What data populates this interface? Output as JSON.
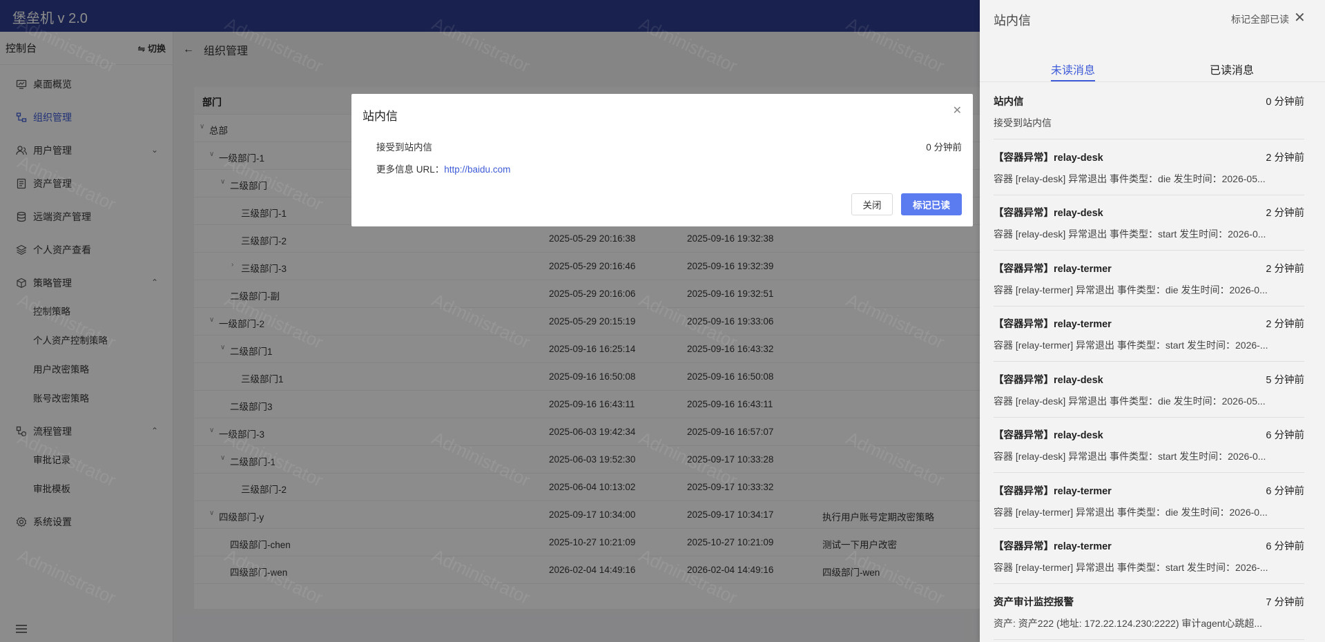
{
  "app": {
    "title": "堡垒机 v 2.0"
  },
  "sidebar": {
    "header_title": "控制台",
    "switch_label": "⇋ 切换",
    "items": [
      {
        "label": "桌面概览",
        "icon": "dashboard-icon"
      },
      {
        "label": "组织管理",
        "icon": "org-icon",
        "active": true
      },
      {
        "label": "用户管理",
        "icon": "users-icon"
      },
      {
        "label": "资产管理",
        "icon": "asset-icon"
      },
      {
        "label": "远端资产管理",
        "icon": "database-icon"
      },
      {
        "label": "个人资产查看",
        "icon": "layers-icon"
      },
      {
        "label": "策略管理",
        "icon": "cube-icon"
      },
      {
        "label": "流程管理",
        "icon": "flow-icon"
      },
      {
        "label": "系统设置",
        "icon": "settings-icon"
      }
    ],
    "policy_subitems": [
      "控制策略",
      "个人资产控制策略",
      "用户改密策略",
      "账号改密策略"
    ],
    "flow_subitems": [
      "审批记录",
      "审批模板"
    ]
  },
  "main": {
    "breadcrumb": "组织管理",
    "table": {
      "header_dept": "部门",
      "rows": [
        {
          "name": "总部",
          "created": "",
          "updated": "",
          "desc": ""
        },
        {
          "name": "一级部门-1",
          "created": "",
          "updated": "",
          "desc": ""
        },
        {
          "name": "二级部门",
          "created": "",
          "updated": "",
          "desc": ""
        },
        {
          "name": "三级部门-1",
          "created": "",
          "updated": "",
          "desc": ""
        },
        {
          "name": "三级部门-2",
          "created": "2025-05-29 20:16:38",
          "updated": "2025-09-16 19:32:38",
          "desc": ""
        },
        {
          "name": "三级部门-3",
          "created": "2025-05-29 20:16:46",
          "updated": "2025-09-16 19:32:39",
          "desc": ""
        },
        {
          "name": "二级部门-副",
          "created": "2025-05-29 20:16:06",
          "updated": "2025-09-16 19:32:51",
          "desc": ""
        },
        {
          "name": "一级部门-2",
          "created": "2025-05-29 20:15:19",
          "updated": "2025-09-16 19:33:06",
          "desc": ""
        },
        {
          "name": "二级部门1",
          "created": "2025-09-16 16:25:14",
          "updated": "2025-09-16 16:43:32",
          "desc": ""
        },
        {
          "name": "三级部门1",
          "created": "2025-09-16 16:50:08",
          "updated": "2025-09-16 16:50:08",
          "desc": ""
        },
        {
          "name": "二级部门3",
          "created": "2025-09-16 16:43:11",
          "updated": "2025-09-16 16:43:11",
          "desc": ""
        },
        {
          "name": "一级部门-3",
          "created": "2025-06-03 19:42:34",
          "updated": "2025-09-16 16:57:07",
          "desc": ""
        },
        {
          "name": "二级部门-1",
          "created": "2025-06-03 19:52:30",
          "updated": "2025-09-17 10:33:28",
          "desc": ""
        },
        {
          "name": "三级部门-2",
          "created": "2025-06-04 10:13:02",
          "updated": "2025-09-17 10:33:32",
          "desc": ""
        },
        {
          "name": "四级部门-y",
          "created": "2025-09-17 10:34:00",
          "updated": "2025-09-17 10:34:17",
          "desc": "执行用户账号定期改密策略"
        },
        {
          "name": "四级部门-chen",
          "created": "2025-10-27 10:21:09",
          "updated": "2025-10-27 10:21:09",
          "desc": "测试一下用户改密"
        },
        {
          "name": "四级部门-wen",
          "created": "2026-02-04 14:49:16",
          "updated": "2026-02-04 14:49:16",
          "desc": "四级部门-wen"
        }
      ]
    }
  },
  "watermark": "Administrator",
  "modal": {
    "title": "站内信",
    "content": "接受到站内信",
    "time": "0 分钟前",
    "url_label": "更多信息 URL：",
    "url": "http://baidu.com",
    "close_label": "关闭",
    "mark_read_label": "标记已读"
  },
  "drawer": {
    "title": "站内信",
    "mark_all_label": "标记全部已读",
    "tabs": {
      "unread": "未读消息",
      "read": "已读消息"
    },
    "messages": [
      {
        "title": "站内信",
        "time": "0 分钟前",
        "desc": "接受到站内信"
      },
      {
        "title": "【容器异常】relay-desk",
        "time": "2 分钟前",
        "desc": "容器 [relay-desk] 异常退出 事件类型：die 发生时间：2026-05..."
      },
      {
        "title": "【容器异常】relay-desk",
        "time": "2 分钟前",
        "desc": "容器 [relay-desk] 异常退出 事件类型：start 发生时间：2026-0..."
      },
      {
        "title": "【容器异常】relay-termer",
        "time": "2 分钟前",
        "desc": "容器 [relay-termer] 异常退出 事件类型：die 发生时间：2026-0..."
      },
      {
        "title": "【容器异常】relay-termer",
        "time": "2 分钟前",
        "desc": "容器 [relay-termer] 异常退出 事件类型：start 发生时间：2026-..."
      },
      {
        "title": "【容器异常】relay-desk",
        "time": "5 分钟前",
        "desc": "容器 [relay-desk] 异常退出 事件类型：die 发生时间：2026-05..."
      },
      {
        "title": "【容器异常】relay-desk",
        "time": "6 分钟前",
        "desc": "容器 [relay-desk] 异常退出 事件类型：start 发生时间：2026-0..."
      },
      {
        "title": "【容器异常】relay-termer",
        "time": "6 分钟前",
        "desc": "容器 [relay-termer] 异常退出 事件类型：die 发生时间：2026-0..."
      },
      {
        "title": "【容器异常】relay-termer",
        "time": "6 分钟前",
        "desc": "容器 [relay-termer] 异常退出 事件类型：start 发生时间：2026-..."
      },
      {
        "title": "资产审计监控报警",
        "time": "7 分钟前",
        "desc": "资产: 资产222 (地址: 172.22.124.230:2222) 审计agent心跳超..."
      }
    ]
  },
  "colors": {
    "header": "#2e3d8f",
    "accent": "#3e5bd8",
    "primary_button": "#5b7cf0"
  }
}
